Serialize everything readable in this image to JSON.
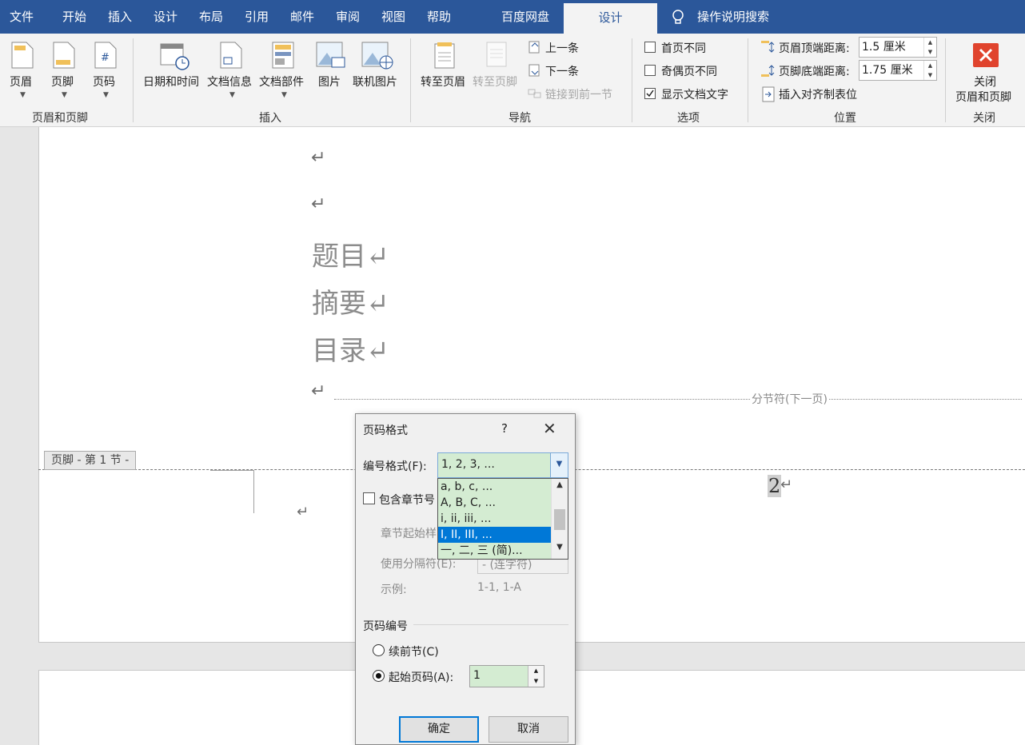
{
  "menubar": {
    "tabs": [
      "文件",
      "开始",
      "插入",
      "设计",
      "布局",
      "引用",
      "邮件",
      "审阅",
      "视图",
      "帮助",
      "百度网盘"
    ],
    "active_tab": "设计",
    "search": "操作说明搜索"
  },
  "ribbon": {
    "header_footer": {
      "header": "页眉",
      "footer": "页脚",
      "page_number": "页码",
      "group": "页眉和页脚"
    },
    "insert": {
      "date_time": "日期和时间",
      "doc_info": "文档信息",
      "doc_parts": "文档部件",
      "picture": "图片",
      "online_picture": "联机图片",
      "group": "插入"
    },
    "navigation": {
      "goto_header": "转至页眉",
      "goto_footer": "转至页脚",
      "previous": "上一条",
      "next": "下一条",
      "link_previous": "链接到前一节",
      "group": "导航"
    },
    "options": {
      "different_first": "首页不同",
      "different_odd_even": "奇偶页不同",
      "show_doc_text": "显示文档文字",
      "show_doc_text_checked": true,
      "group": "选项"
    },
    "position": {
      "header_top_label": "页眉顶端距离:",
      "header_top_value": "1.5 厘米",
      "footer_bottom_label": "页脚底端距离:",
      "footer_bottom_value": "1.75 厘米",
      "insert_align_tab": "插入对齐制表位",
      "group": "位置"
    },
    "close": {
      "line1": "关闭",
      "line2": "页眉和页脚",
      "group": "关闭"
    }
  },
  "document": {
    "para_mark": "↵",
    "headings": [
      "题目↵",
      "摘要↵",
      "目录↵"
    ],
    "section_break": "分节符(下一页)",
    "footer_tag": "页脚 - 第 1 节 -",
    "page_number": "2",
    "page_number_mark": "↵"
  },
  "dialog": {
    "title": "页码格式",
    "help": "?",
    "close": "✕",
    "format_label": "编号格式(F):",
    "format_value": "1, 2, 3, ...",
    "format_options": [
      {
        "label": "a, b, c, ...",
        "selected": false
      },
      {
        "label": "A, B, C, ...",
        "selected": false
      },
      {
        "label": "i, ii, iii, ...",
        "selected": false
      },
      {
        "label": "I, II, III, ...",
        "selected": true
      },
      {
        "label": "一, 二, 三 (简)...",
        "selected": false
      }
    ],
    "include_chapter": "包含章节号",
    "chapter_start_style": "章节起始样",
    "separator_label": "使用分隔符(E):",
    "separator_value": "-  (连字符)",
    "example_label": "示例:",
    "example_value": "1-1, 1-A",
    "numbering_group": "页码编号",
    "continue_label": "续前节(C)",
    "start_label": "起始页码(A):",
    "start_value": "1",
    "ok": "确定",
    "cancel": "取消"
  },
  "colors": {
    "title_bar": "#2b579a",
    "selection": "#0078d7",
    "list_bg": "#d4ecd2",
    "close_red": "#e0432d"
  }
}
